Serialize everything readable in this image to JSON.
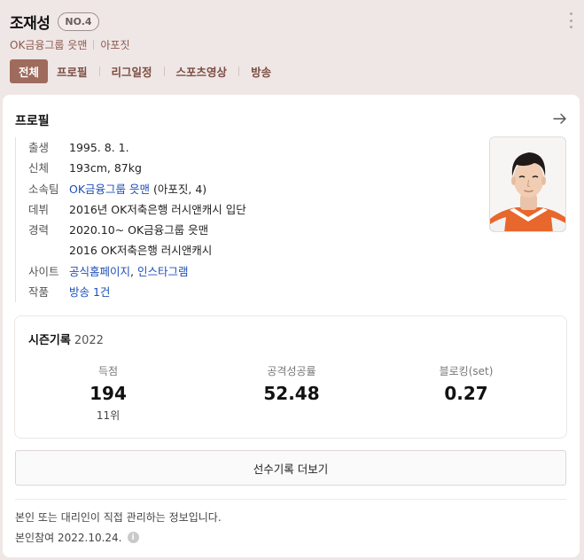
{
  "header": {
    "player_name": "조재성",
    "number": "NO.4",
    "team": "OK금융그룹 읏맨",
    "position": "아포짓"
  },
  "tabs": [
    {
      "label": "전체",
      "active": true
    },
    {
      "label": "프로필",
      "active": false
    },
    {
      "label": "리그일정",
      "active": false
    },
    {
      "label": "스포츠영상",
      "active": false
    },
    {
      "label": "방송",
      "active": false
    }
  ],
  "profile": {
    "title": "프로필",
    "rows": {
      "birth": {
        "label": "출생",
        "value": "1995. 8. 1."
      },
      "body": {
        "label": "신체",
        "value": "193cm, 87kg"
      },
      "team": {
        "label": "소속팀",
        "link": "OK금융그룹 읏맨",
        "extra": " (아포짓, 4)"
      },
      "debut": {
        "label": "데뷔",
        "value": "2016년 OK저축은행 러시앤캐시 입단"
      },
      "career": {
        "label": "경력",
        "line1": "2020.10~ OK금융그룹 읏맨",
        "line2": "2016 OK저축은행 러시앤캐시"
      },
      "site": {
        "label": "사이트",
        "link1": "공식홈페이지",
        "sep": ", ",
        "link2": "인스타그램"
      },
      "works": {
        "label": "작품",
        "link": "방송 1건"
      }
    }
  },
  "season": {
    "title": "시즌기록",
    "year": "2022",
    "stats": [
      {
        "label": "득점",
        "value": "194",
        "rank": "11위"
      },
      {
        "label": "공격성공률",
        "value": "52.48",
        "rank": ""
      },
      {
        "label": "블로킹(set)",
        "value": "0.27",
        "rank": ""
      }
    ]
  },
  "more_button": "선수기록 더보기",
  "footer": {
    "note": "본인 또는 대리인이 직접 관리하는 정보입니다.",
    "date": "본인참여 2022.10.24."
  },
  "icons": {
    "more": "more-vertical-icon",
    "arrow": "arrow-right-icon",
    "info": "info-icon"
  },
  "colors": {
    "background": "#efe7e6",
    "accent": "#9f6b5d",
    "team_text": "#8c5a4e",
    "link": "#1d4fb8"
  }
}
